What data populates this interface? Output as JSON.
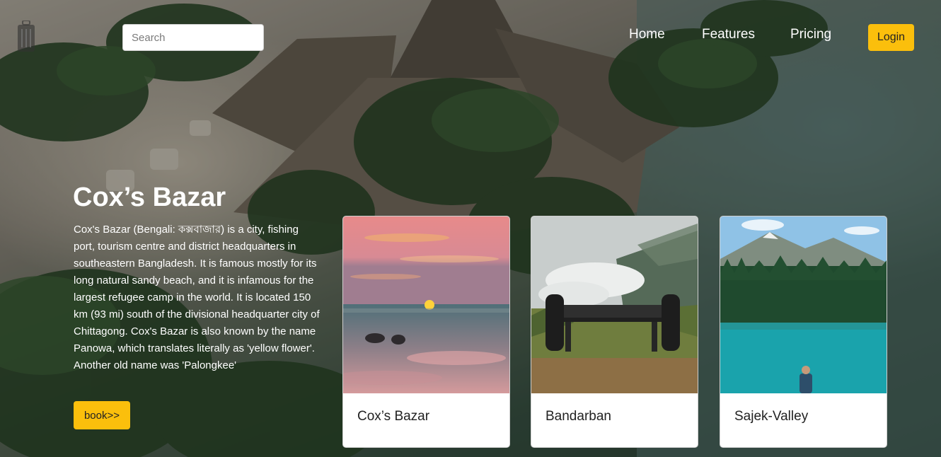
{
  "nav": {
    "logo_text": "",
    "search_placeholder": "Search",
    "links": [
      "Home",
      "Features",
      "Pricing"
    ],
    "login_label": "Login"
  },
  "hero": {
    "title": "Cox’s Bazar",
    "description": "Cox's Bazar (Bengali: কক্সবাজার) is a city, fishing port, tourism centre and district headquarters in southeastern Bangladesh. It is famous mostly for its long natural sandy beach, and it is infamous for the largest refugee camp in the world. It is located 150 km (93 mi) south of the divisional headquarter city of Chittagong. Cox's Bazar is also known by the name Panowa, which translates literally as 'yellow flower'. Another old name was 'Palongkee'",
    "book_label": "book>>"
  },
  "cards": [
    {
      "title": "Cox’s Bazar",
      "image": "sunset-beach-image"
    },
    {
      "title": "Bandarban",
      "image": "hill-bench-image"
    },
    {
      "title": "Sajek-Valley",
      "image": "mountain-lake-image"
    }
  ],
  "colors": {
    "accent": "#fbbf0c",
    "nav_text": "#ffffff",
    "card_bg": "#ffffff"
  }
}
